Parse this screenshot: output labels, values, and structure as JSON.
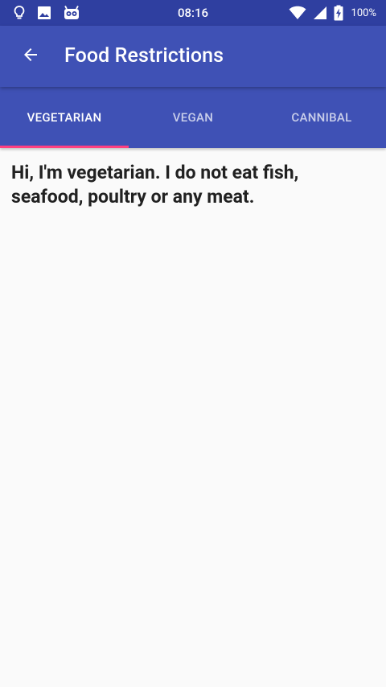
{
  "status_bar": {
    "time": "08:16",
    "battery_percent": "100%",
    "left_icons": [
      "lightbulb-icon",
      "image-icon",
      "android-debug-icon"
    ],
    "right_icons": [
      "wifi-icon",
      "cell-signal-icon",
      "battery-charging-icon"
    ]
  },
  "app_bar": {
    "title": "Food Restrictions",
    "back_icon": "arrow-back-icon",
    "background_color": "#3f51b5"
  },
  "tabs": {
    "items": [
      {
        "label": "VEGETARIAN",
        "selected": true
      },
      {
        "label": "VEGAN",
        "selected": false
      },
      {
        "label": "CANNIBAL",
        "selected": false
      }
    ],
    "indicator_color": "#ff4081"
  },
  "content": {
    "text": "Hi, I'm vegetarian. I do not eat fish, seafood, poultry or any meat."
  }
}
